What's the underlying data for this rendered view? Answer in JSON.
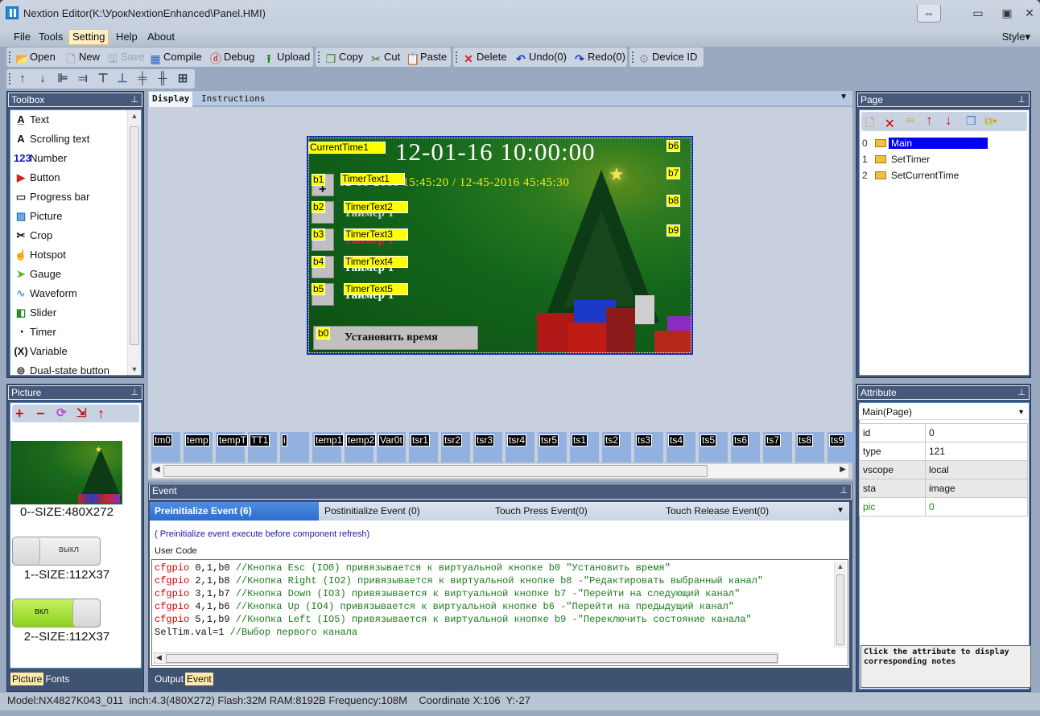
{
  "window": {
    "title": "Nextion Editor(K:\\УрокNextionEnhanced\\Panel.HMI)"
  },
  "menu": {
    "items": [
      "File",
      "Tools",
      "Setting",
      "Help",
      "About"
    ],
    "active": "Setting",
    "style_label": "Style▾"
  },
  "toolbar": {
    "open": "Open",
    "new": "New",
    "save": "Save",
    "compile": "Compile",
    "debug": "Debug",
    "upload": "Upload",
    "copy": "Copy",
    "cut": "Cut",
    "paste": "Paste",
    "delete": "Delete",
    "undo": "Undo(0)",
    "redo": "Redo(0)",
    "device_id": "Device  ID"
  },
  "toolbox": {
    "title": "Toolbox",
    "items": [
      {
        "label": "Text",
        "icon": "A̲"
      },
      {
        "label": "Scrolling text",
        "icon": "A"
      },
      {
        "label": "Number",
        "icon": "123"
      },
      {
        "label": "Button",
        "icon": "▶"
      },
      {
        "label": "Progress bar",
        "icon": "▭"
      },
      {
        "label": "Picture",
        "icon": "▨"
      },
      {
        "label": "Crop",
        "icon": "✂"
      },
      {
        "label": "Hotspot",
        "icon": "☝"
      },
      {
        "label": "Gauge",
        "icon": "➤"
      },
      {
        "label": "Waveform",
        "icon": "∿"
      },
      {
        "label": "Slider",
        "icon": "◧"
      },
      {
        "label": "Timer",
        "icon": "◔"
      },
      {
        "label": "Variable",
        "icon": "(X)"
      },
      {
        "label": "Dual-state button",
        "icon": "⊜"
      }
    ]
  },
  "picture_panel": {
    "title": "Picture",
    "items": [
      {
        "label": "0--SIZE:480X272"
      },
      {
        "label": "1--SIZE:112X37",
        "text": "выкл"
      },
      {
        "label": "2--SIZE:112X37",
        "text": "вкл"
      }
    ],
    "tabs": [
      "Picture",
      "Fonts"
    ],
    "active_tab": "Picture"
  },
  "doc_tabs": {
    "items": [
      "Display",
      "Instructions"
    ],
    "active": "Display"
  },
  "canvas": {
    "clock_text": "12-01-16 10:00:00",
    "timer_line": "12-01-2016 15:45:20  / 12-45-2016 45:45:30",
    "timer_ru": "Таймер 1",
    "b0_text": "Установить время",
    "labels": {
      "current_time": "CurrentTime1",
      "timer_texts": [
        "TimerText1",
        "TimerText2",
        "TimerText3",
        "TimerText4",
        "TimerText5"
      ],
      "buttons_left": [
        "b1",
        "b2",
        "b3",
        "b4",
        "b5"
      ],
      "buttons_right": [
        "b6",
        "b7",
        "b8",
        "b9"
      ],
      "b0": "b0"
    }
  },
  "variables": [
    "tm0",
    "temp",
    "tempT",
    "TT1",
    "i",
    "temp1",
    "temp2",
    "Var0t",
    "tsr1",
    "tsr2",
    "tsr3",
    "tsr4",
    "tsr5",
    "ts1",
    "ts2",
    "ts3",
    "ts4",
    "ts5",
    "ts6",
    "ts7",
    "ts8",
    "ts9"
  ],
  "event_panel": {
    "title": "Event",
    "tabs": [
      "Preinitialize Event (6)",
      "Postinitialize Event (0)",
      "Touch Press Event(0)",
      "Touch Release Event(0)"
    ],
    "active_tab": "Preinitialize Event (6)",
    "note": "( Preinitialize event execute before component refresh)",
    "user_code_label": "User Code",
    "code_lines": [
      {
        "kw": "cfgpio",
        "args": " 0,1,b0 ",
        "comment": "//Кнопка Esc (IO0) привязывается к виртуальной кнопке b0 \"Установить время\""
      },
      {
        "kw": "cfgpio",
        "args": " 2,1,b8 ",
        "comment": "//Кнопка Right (IO2) привязывается к виртуальной кнопке b8 -\"Редактировать выбранный канал\""
      },
      {
        "kw": "cfgpio",
        "args": " 3,1,b7 ",
        "comment": "//Кнопка Down (IO3) привязывается к виртуальной кнопке b7 -\"Перейти на следующий канал\""
      },
      {
        "kw": "cfgpio",
        "args": " 4,1,b6 ",
        "comment": "//Кнопка Up (IO4) привязывается к виртуальной кнопке b6 -\"Перейти на предыдущий канал\""
      },
      {
        "kw": "cfgpio",
        "args": " 5,1,b9 ",
        "comment": "//Кнопка Left (IO5) привязывается к виртуальной кнопке b9 -\"Переключить состояние канала\""
      },
      {
        "kw": "",
        "args": "SelTim.val=1 ",
        "comment": "//Выбор первого канала"
      }
    ],
    "bottom_tabs": [
      "Output",
      "Event"
    ],
    "active_bottom_tab": "Event"
  },
  "page_panel": {
    "title": "Page",
    "pages": [
      {
        "index": "0",
        "name": "Main",
        "selected": true
      },
      {
        "index": "1",
        "name": "SetTimer"
      },
      {
        "index": "2",
        "name": "SetCurrentTime"
      }
    ]
  },
  "attribute_panel": {
    "title": "Attribute",
    "selected_object": "Main(Page)",
    "rows": [
      {
        "name": "id",
        "value": "0"
      },
      {
        "name": "type",
        "value": "121"
      },
      {
        "name": "vscope",
        "value": "local"
      },
      {
        "name": "sta",
        "value": "image"
      },
      {
        "name": "pic",
        "value": "0"
      }
    ],
    "notes": "Click the attribute to display corresponding notes"
  },
  "status_bar": "Model:NX4827K043_011  inch:4.3(480X272) Flash:32M RAM:8192B Frequency:108M    Coordinate X:106  Y:-27"
}
